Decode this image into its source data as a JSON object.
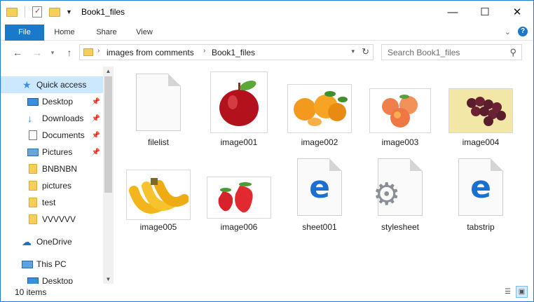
{
  "window": {
    "title": "Book1_files"
  },
  "ribbon": {
    "tabs": {
      "file": "File",
      "home": "Home",
      "share": "Share",
      "view": "View"
    }
  },
  "address": {
    "crumbs": [
      "images from comments",
      "Book1_files"
    ]
  },
  "search": {
    "placeholder": "Search Book1_files"
  },
  "nav": {
    "items": [
      {
        "label": "Quick access",
        "icon": "star-icon"
      },
      {
        "label": "Desktop",
        "icon": "desktop-icon",
        "pinned": true
      },
      {
        "label": "Downloads",
        "icon": "download-icon",
        "pinned": true
      },
      {
        "label": "Documents",
        "icon": "documents-icon",
        "pinned": true
      },
      {
        "label": "Pictures",
        "icon": "pictures-icon",
        "pinned": true
      },
      {
        "label": "BNBNBN",
        "icon": "folder-icon"
      },
      {
        "label": "pictures",
        "icon": "folder-icon"
      },
      {
        "label": "test",
        "icon": "folder-icon"
      },
      {
        "label": "VVVVVV",
        "icon": "folder-icon"
      },
      {
        "label": "OneDrive",
        "icon": "cloud-icon"
      },
      {
        "label": "This PC",
        "icon": "computer-icon"
      },
      {
        "label": "Desktop",
        "icon": "desktop-icon"
      }
    ]
  },
  "files": [
    {
      "name": "filelist",
      "kind": "generic-file-icon"
    },
    {
      "name": "image001",
      "kind": "apple-thumbnail"
    },
    {
      "name": "image002",
      "kind": "oranges-thumbnail"
    },
    {
      "name": "image003",
      "kind": "peaches-thumbnail"
    },
    {
      "name": "image004",
      "kind": "grapes-thumbnail"
    },
    {
      "name": "image005",
      "kind": "bananas-thumbnail"
    },
    {
      "name": "image006",
      "kind": "strawberries-thumbnail"
    },
    {
      "name": "sheet001",
      "kind": "edge-html-icon"
    },
    {
      "name": "stylesheet",
      "kind": "gear-settings-icon"
    },
    {
      "name": "tabstrip",
      "kind": "edge-html-icon"
    }
  ],
  "status": {
    "count": "10 items"
  },
  "colors": {
    "accent": "#1979ca",
    "selection": "#cce8ff",
    "folder": "#f5cf5c"
  }
}
